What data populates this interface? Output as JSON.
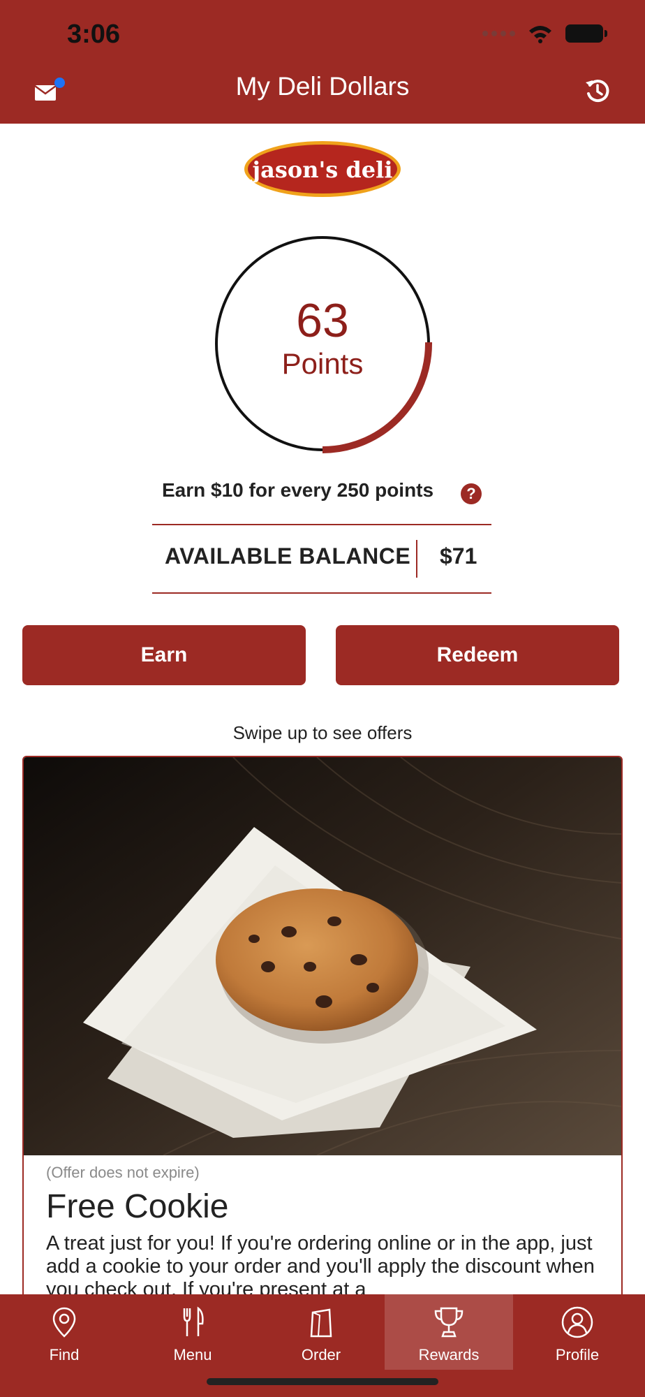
{
  "status_bar": {
    "time": "3:06"
  },
  "header": {
    "title": "My Deli Dollars"
  },
  "brand": {
    "logo_text": "jason's deli"
  },
  "rewards": {
    "points": "63",
    "points_label": "Points",
    "progress_fraction": 0.252,
    "earn_info": "Earn $10 for every 250 points",
    "help_symbol": "?",
    "balance_label": "AVAILABLE BALANCE",
    "balance_value": "$71"
  },
  "actions": {
    "earn_label": "Earn",
    "redeem_label": "Redeem"
  },
  "offers": {
    "swipe_hint": "Swipe up to see offers",
    "items": [
      {
        "expiry": "(Offer does not expire)",
        "title": "Free Cookie",
        "description": "A treat just for you! If you're ordering online or in the app, just add a cookie to your order and you'll apply the discount when you check out. If you're present at a"
      }
    ]
  },
  "tabbar": {
    "items": [
      {
        "label": "Find",
        "icon": "location-pin-icon"
      },
      {
        "label": "Menu",
        "icon": "fork-knife-icon"
      },
      {
        "label": "Order",
        "icon": "bag-icon"
      },
      {
        "label": "Rewards",
        "icon": "trophy-icon",
        "active": true
      },
      {
        "label": "Profile",
        "icon": "person-icon"
      }
    ]
  },
  "colors": {
    "brand_red": "#9c2a24",
    "accent_blue": "#1e73f5",
    "text": "#222222"
  }
}
